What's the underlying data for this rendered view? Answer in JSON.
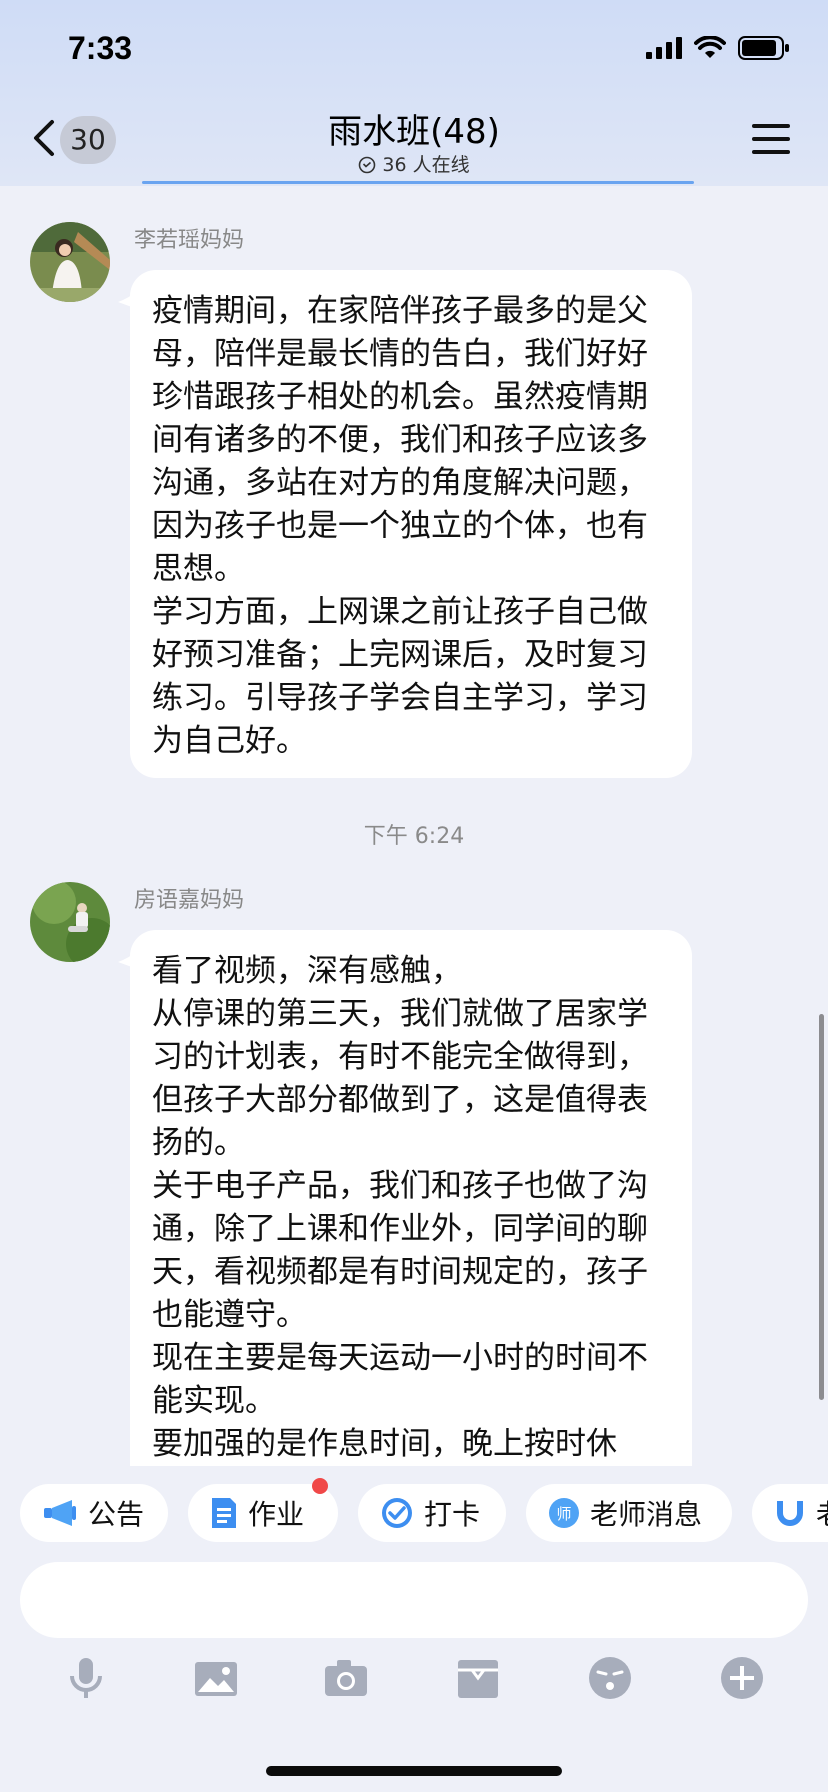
{
  "status_bar": {
    "time": "7:33"
  },
  "header": {
    "back_count": "30",
    "title": "雨水班(48)",
    "online_text": "36 人在线",
    "icons": [
      "chevron-left-icon",
      "check-circle-icon",
      "menu-icon"
    ]
  },
  "messages": [
    {
      "sender": "李若瑶妈妈",
      "lines": [
        "疫情期间，在家陪伴孩子最多的是父母，陪伴是最长情的告白，我们好好珍惜跟孩子相处的机会。虽然疫情期间有诸多的不便，我们和孩子应该多沟通，多站在对方的角度解决问题，因为孩子也是一个独立的个体，也有思想。",
        "学习方面，上网课之前让孩子自己做好预习准备；上完网课后，及时复习练习。引导孩子学会自主学习，学习为自己好。"
      ]
    },
    {
      "sender": "房语嘉妈妈",
      "lines": [
        "看了视频，深有感触，",
        "从停课的第三天，我们就做了居家学习的计划表，有时不能完全做得到，但孩子大部分都做到了，这是值得表扬的。",
        "关于电子产品，我们和孩子也做了沟通，除了上课和作业外，同学间的聊天，看视频都是有时间规定的，孩子也能遵守。",
        "现在主要是每天运动一小时的时间不能实现。",
        "要加强的是作息时间，晚上按时休息，目录控制规定，至能会打乱"
      ]
    }
  ],
  "timestamp": "下午 6:24",
  "quick_actions": [
    {
      "label": "公告",
      "icon": "megaphone-icon"
    },
    {
      "label": "作业",
      "icon": "document-icon",
      "badge": true
    },
    {
      "label": "打卡",
      "icon": "checkmark-badge-icon"
    },
    {
      "label": "老师消息",
      "icon": "teacher-icon"
    },
    {
      "label": "老",
      "icon": "magnet-icon"
    }
  ],
  "toolbar": [
    "microphone-icon",
    "image-icon",
    "camera-icon",
    "box-icon",
    "emoji-icon",
    "plus-icon"
  ],
  "colors": {
    "accent": "#3d8ef0",
    "badge": "#f04848",
    "background": "#eef0f8"
  }
}
